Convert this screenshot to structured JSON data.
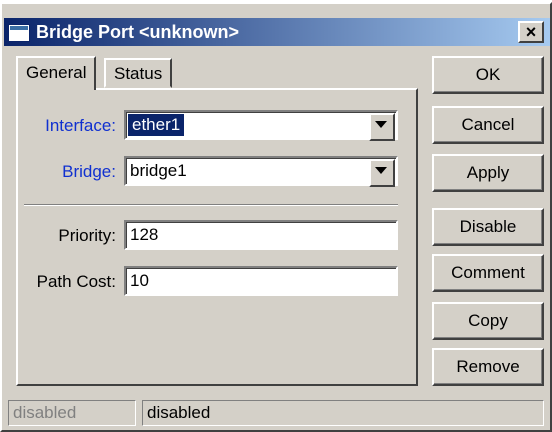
{
  "window": {
    "title": "Bridge Port <unknown>",
    "close_label": "×"
  },
  "tabs": [
    {
      "label": "General",
      "active": true
    },
    {
      "label": "Status",
      "active": false
    }
  ],
  "form": {
    "interface": {
      "label": "Interface:",
      "value": "ether1"
    },
    "bridge": {
      "label": "Bridge:",
      "value": "bridge1"
    },
    "priority": {
      "label": "Priority:",
      "value": "128"
    },
    "path_cost": {
      "label": "Path Cost:",
      "value": "10"
    }
  },
  "buttons": {
    "ok": "OK",
    "cancel": "Cancel",
    "apply": "Apply",
    "disable": "Disable",
    "comment": "Comment",
    "copy": "Copy",
    "remove": "Remove"
  },
  "status": {
    "left": "disabled",
    "right": "disabled"
  },
  "colors": {
    "title_bar": "#0a246a",
    "link_label": "#1030d0",
    "selection": "#0a246a"
  },
  "icons": [
    "window-icon",
    "close-icon",
    "dropdown-arrow-icon"
  ]
}
